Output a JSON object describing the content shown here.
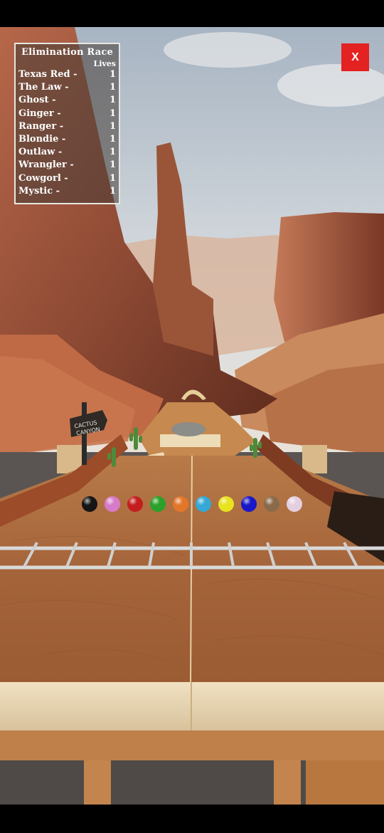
{
  "leaderboard": {
    "title": "Elimination Race",
    "column_label": "Lives",
    "racers": [
      {
        "name": "Texas Red -",
        "lives": "1"
      },
      {
        "name": "The Law -",
        "lives": "1"
      },
      {
        "name": "Ghost -",
        "lives": "1"
      },
      {
        "name": "Ginger -",
        "lives": "1"
      },
      {
        "name": "Ranger -",
        "lives": "1"
      },
      {
        "name": "Blondie -",
        "lives": "1"
      },
      {
        "name": "Outlaw -",
        "lives": "1"
      },
      {
        "name": "Wrangler -",
        "lives": "1"
      },
      {
        "name": "Cowgorl -",
        "lives": "1"
      },
      {
        "name": "Mystic -",
        "lives": "1"
      }
    ]
  },
  "close_button": {
    "label": "X",
    "color": "#e42222"
  },
  "sign": {
    "line1": "CACTUS",
    "line2": "CANYON"
  },
  "marbles": [
    {
      "color": "#151515",
      "icon": "black-marble"
    },
    {
      "color": "#d77bc9",
      "icon": "pink-marble"
    },
    {
      "color": "#c41d1d",
      "icon": "red-marble"
    },
    {
      "color": "#2aa12a",
      "icon": "green-marble"
    },
    {
      "color": "#e4762a",
      "icon": "orange-marble"
    },
    {
      "color": "#35a8d6",
      "icon": "cyan-marble"
    },
    {
      "color": "#e8e21f",
      "icon": "yellow-marble"
    },
    {
      "color": "#1818c8",
      "icon": "blue-marble"
    },
    {
      "color": "#8a6a4a",
      "icon": "stone-marble"
    },
    {
      "color": "#e3cfe0",
      "icon": "pearl-marble"
    }
  ]
}
